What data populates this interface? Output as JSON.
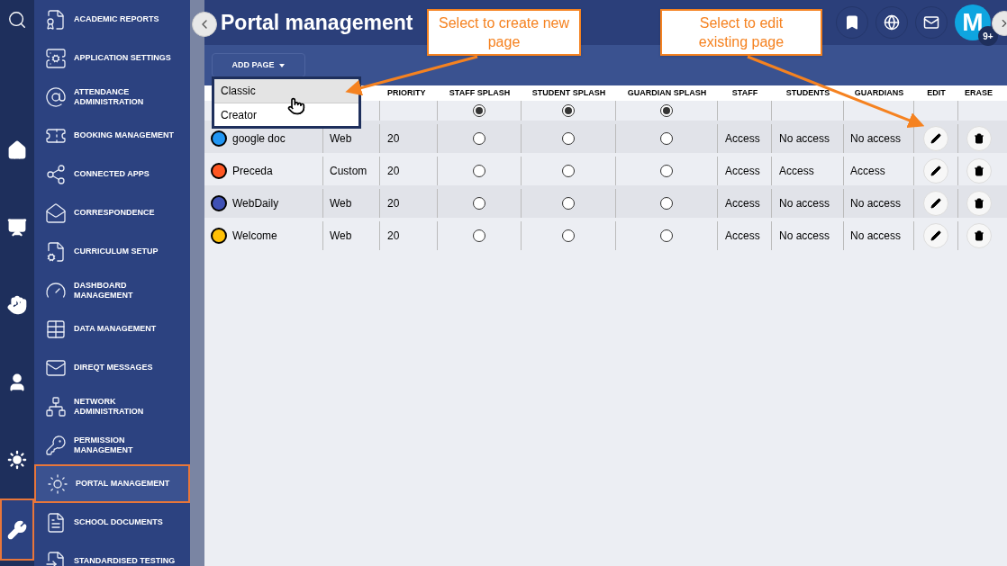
{
  "rail": [
    {
      "kind": "search",
      "selected": false
    },
    {
      "kind": "home",
      "selected": false
    },
    {
      "kind": "easel",
      "selected": false
    },
    {
      "kind": "hand",
      "selected": false
    },
    {
      "kind": "user",
      "selected": false
    },
    {
      "kind": "burst",
      "selected": false
    },
    {
      "kind": "wrench",
      "selected": true
    }
  ],
  "menu": [
    {
      "label": "ACADEMIC REPORTS",
      "selected": false
    },
    {
      "label": "APPLICATION SETTINGS",
      "selected": false
    },
    {
      "label": "ATTENDANCE ADMINISTRATION",
      "selected": false
    },
    {
      "label": "BOOKING MANAGEMENT",
      "selected": false
    },
    {
      "label": "CONNECTED APPS",
      "selected": false
    },
    {
      "label": "CORRESPONDENCE",
      "selected": false
    },
    {
      "label": "CURRICULUM SETUP",
      "selected": false
    },
    {
      "label": "DASHBOARD MANAGEMENT",
      "selected": false
    },
    {
      "label": "DATA MANAGEMENT",
      "selected": false
    },
    {
      "label": "DIREQT MESSAGES",
      "selected": false
    },
    {
      "label": "NETWORK ADMINISTRATION",
      "selected": false
    },
    {
      "label": "PERMISSION MANAGEMENT",
      "selected": false
    },
    {
      "label": "PORTAL MANAGEMENT",
      "selected": true
    },
    {
      "label": "SCHOOL DOCUMENTS",
      "selected": false
    },
    {
      "label": "STANDARDISED TESTING",
      "selected": false
    }
  ],
  "page": {
    "title": "Portal management"
  },
  "header_actions": {
    "avatar": "M",
    "badge": "9+"
  },
  "toolbar": {
    "add_button": "ADD PAGE",
    "dropdown": [
      {
        "label": "Classic",
        "selected": true
      },
      {
        "label": "Creator",
        "selected": false
      }
    ]
  },
  "table": {
    "columns": [
      "PRIORITY",
      "STAFF SPLASH",
      "STUDENT SPLASH",
      "GUARDIAN SPLASH",
      "STAFF",
      "STUDENTS",
      "GUARDIANS",
      "EDIT",
      "ERASE"
    ],
    "default_row": {
      "staff_splash": true,
      "student_splash": true,
      "guardian_splash": true
    },
    "rows": [
      {
        "name": "google doc",
        "color": "#2196f3",
        "type": "Web",
        "priority": "20",
        "staff_splash": false,
        "student_splash": false,
        "guardian_splash": false,
        "staff": "Access",
        "students": "No access",
        "guardians": "No access"
      },
      {
        "name": "Preceda",
        "color": "#ff5722",
        "type": "Custom",
        "priority": "20",
        "staff_splash": false,
        "student_splash": false,
        "guardian_splash": false,
        "staff": "Access",
        "students": "Access",
        "guardians": "Access"
      },
      {
        "name": "WebDaily",
        "color": "#3f51b5",
        "type": "Web",
        "priority": "20",
        "staff_splash": false,
        "student_splash": false,
        "guardian_splash": false,
        "staff": "Access",
        "students": "No access",
        "guardians": "No access"
      },
      {
        "name": "Welcome",
        "color": "#ffc107",
        "type": "Web",
        "priority": "20",
        "staff_splash": false,
        "student_splash": false,
        "guardian_splash": false,
        "staff": "Access",
        "students": "No access",
        "guardians": "No access"
      }
    ]
  },
  "callouts": [
    "Select to create new page",
    "Select to edit existing page"
  ]
}
